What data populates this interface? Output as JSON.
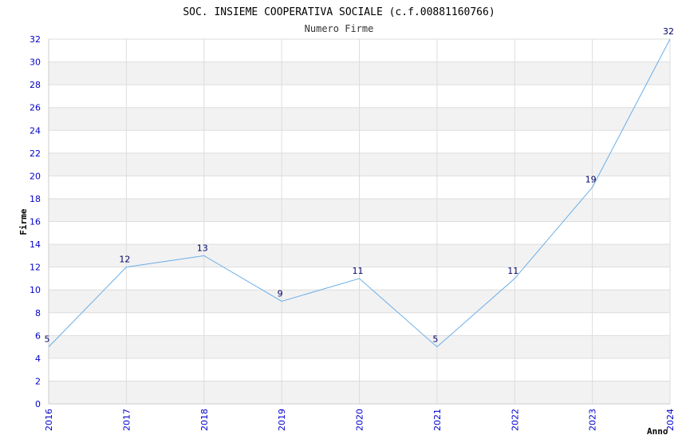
{
  "chart_data": {
    "type": "line",
    "title": "SOC. INSIEME COOPERATIVA SOCIALE (c.f.00881160766)",
    "subtitle": "Numero Firme",
    "xlabel": "Anno",
    "ylabel": "Firme",
    "x": [
      "2016",
      "2017",
      "2018",
      "2019",
      "2020",
      "2021",
      "2022",
      "2023",
      "2024"
    ],
    "values": [
      5,
      12,
      13,
      9,
      11,
      5,
      11,
      19,
      32
    ],
    "data_labels": [
      "5",
      "12",
      "13",
      "9",
      "11",
      "5",
      "11",
      "19",
      "32"
    ],
    "y_ticks": [
      "0",
      "2",
      "4",
      "6",
      "8",
      "10",
      "12",
      "14",
      "16",
      "18",
      "20",
      "22",
      "24",
      "26",
      "28",
      "30",
      "32"
    ],
    "ylim": [
      0,
      32
    ],
    "grid": true,
    "legend": "none",
    "colors": {
      "line": "#6aaee8",
      "band": "#f2f2f2",
      "grid": "#dddddd",
      "tick_text": "#0000cc",
      "data_label": "#000066"
    }
  }
}
